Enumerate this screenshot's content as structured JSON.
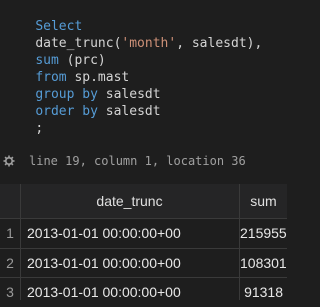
{
  "editor": {
    "lines": [
      [
        {
          "t": "Select",
          "c": "kw"
        }
      ],
      [
        {
          "t": "date_trunc(",
          "c": "pl"
        },
        {
          "t": "'month'",
          "c": "str"
        },
        {
          "t": ", salesdt),",
          "c": "pl"
        }
      ],
      [
        {
          "t": "sum",
          "c": "kw"
        },
        {
          "t": " (prc)",
          "c": "pl"
        }
      ],
      [
        {
          "t": "from",
          "c": "kw"
        },
        {
          "t": " sp.mast",
          "c": "pl"
        }
      ],
      [
        {
          "t": "group by",
          "c": "kw"
        },
        {
          "t": " salesdt",
          "c": "pl"
        }
      ],
      [
        {
          "t": "order by",
          "c": "kw"
        },
        {
          "t": " salesdt",
          "c": "pl"
        }
      ],
      [
        {
          "t": ";",
          "c": "pl"
        }
      ]
    ]
  },
  "status": {
    "icon": "gear-icon",
    "text": "line 19, column 1, location 36"
  },
  "results": {
    "columns": [
      "date_trunc",
      "sum"
    ],
    "rows": [
      {
        "num": "1",
        "date_trunc": "2013-01-01 00:00:00+00",
        "sum": "215955"
      },
      {
        "num": "2",
        "date_trunc": "2013-01-01 00:00:00+00",
        "sum": "108301"
      },
      {
        "num": "3",
        "date_trunc": "2013-01-01 00:00:00+00",
        "sum": "91318"
      }
    ]
  }
}
